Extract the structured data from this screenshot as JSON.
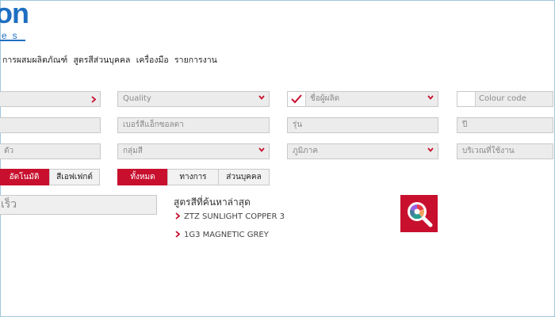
{
  "logo": {
    "main": "on",
    "sub": "es"
  },
  "menu": [
    "การผสมผลิตภัณฑ์",
    "สูตรสีส่วนบุคคล",
    "เครื่องมือ",
    "รายการงาน"
  ],
  "row1": {
    "quality_placeholder": "Quality",
    "manufacturer_placeholder": "ชื่อผู้ผลิต",
    "colour_code_placeholder": "Colour code"
  },
  "row2": {
    "mix_number_placeholder": "เบอร์สีแอ็กซอลตา",
    "model_placeholder": "รุ่น",
    "year_placeholder": "ปี"
  },
  "row3": {
    "partial_label": "ตัว",
    "colour_group_placeholder": "กลุ่มสี",
    "region_placeholder": "ภูมิภาค",
    "usage_area_placeholder": "บริเวณที่ใช้งาน"
  },
  "mode_toggle": [
    "อัตโนมัติ",
    "สีเอฟเฟกต์"
  ],
  "filter_toggle": [
    "ทั้งหมด",
    "ทางการ",
    "ส่วนบุคคล"
  ],
  "quick_search_placeholder": "เร็ว",
  "recent": {
    "title": "สูตรสีที่ค้นหาล่าสุด",
    "items": [
      "ZTZ SUNLIGHT COPPER 3",
      "1G3 MAGNETIC GREY"
    ]
  },
  "colors": {
    "accent": "#c8102e",
    "brand": "#1e6fc1",
    "field_bg": "#ececec"
  }
}
